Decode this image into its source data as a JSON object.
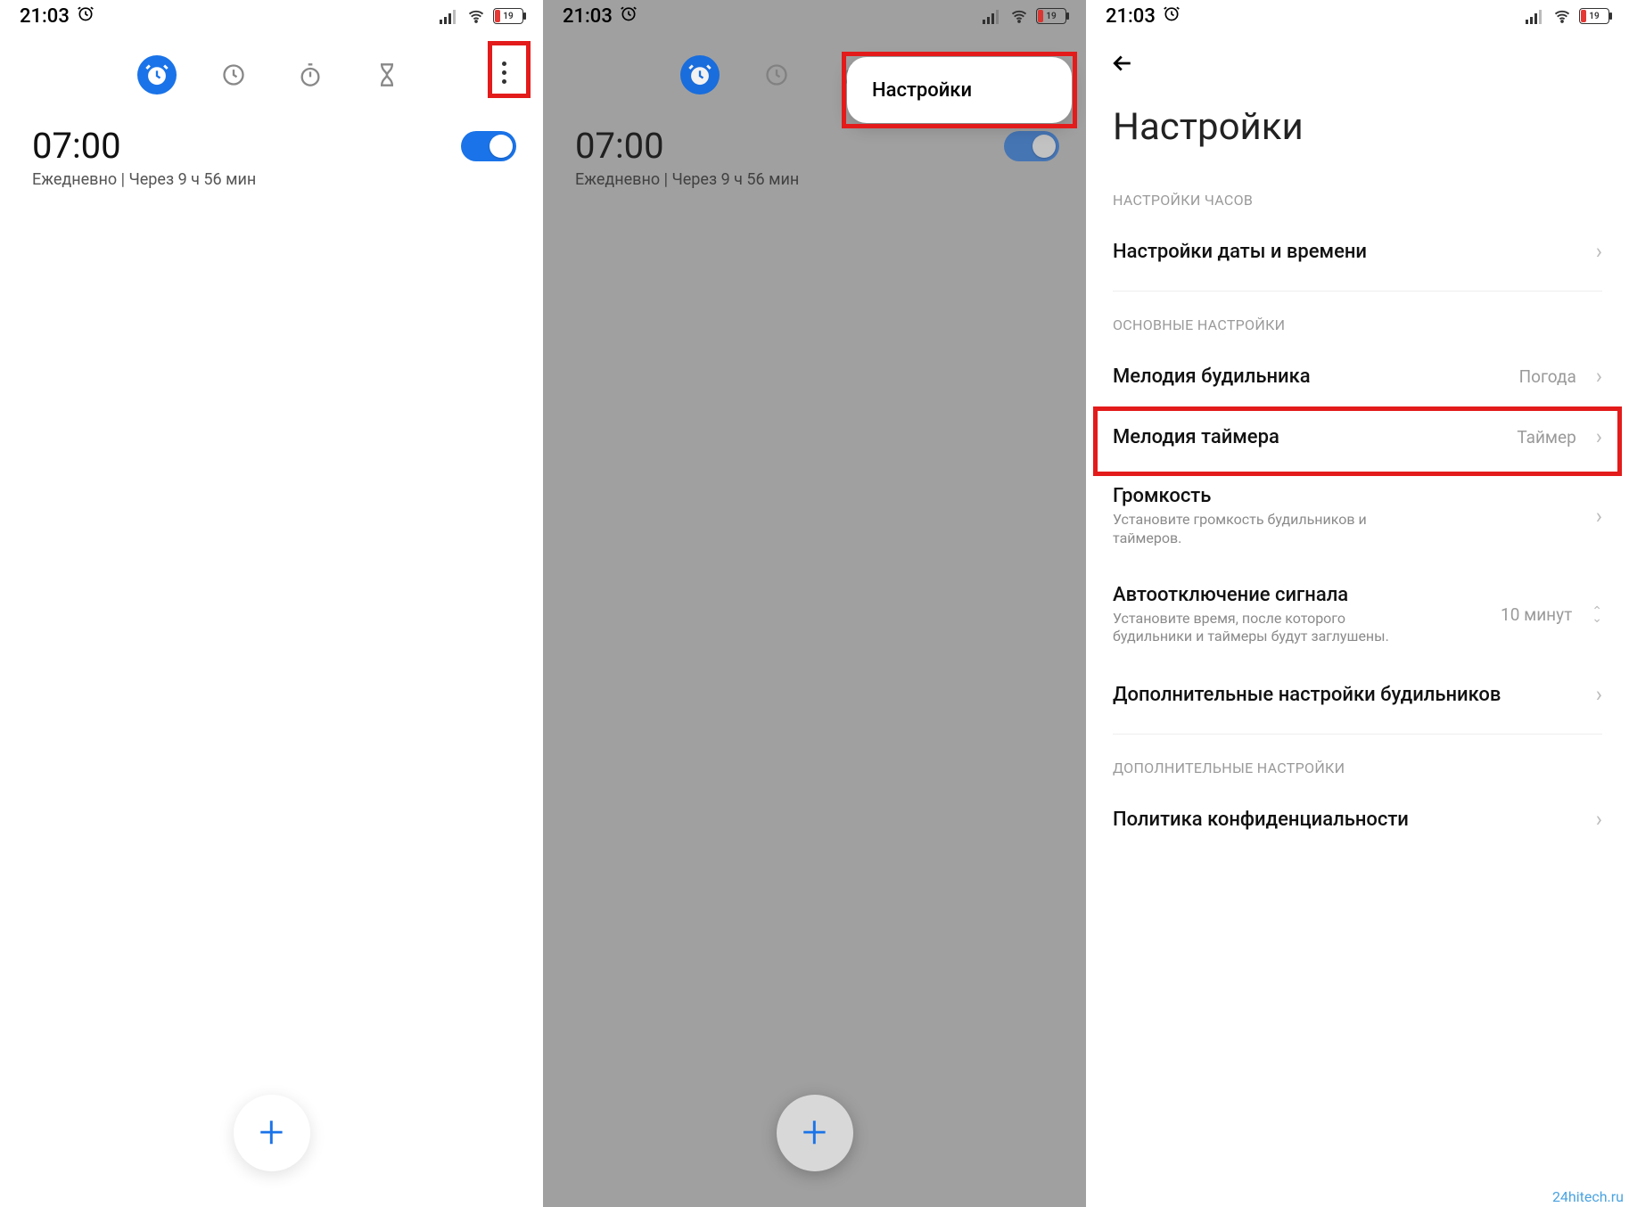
{
  "status": {
    "time": "21:03",
    "battery_text": "19"
  },
  "screen1": {
    "alarm_time": "07:00",
    "alarm_sub": "Ежедневно  |  Через 9 ч 56 мин"
  },
  "screen2": {
    "alarm_time": "07:00",
    "alarm_sub": "Ежедневно  |  Через 9 ч 56 мин",
    "popup_label": "Настройки"
  },
  "screen3": {
    "title": "Настройки",
    "section_clock": "НАСТРОЙКИ ЧАСОВ",
    "row_date_time": "Настройки даты и времени",
    "section_main": "ОСНОВНЫЕ НАСТРОЙКИ",
    "row_alarm_ringtone": "Мелодия будильника",
    "row_alarm_ringtone_value": "Погода",
    "row_timer_ringtone": "Мелодия таймера",
    "row_timer_ringtone_value": "Таймер",
    "row_volume": "Громкость",
    "row_volume_desc": "Установите громкость будильников и таймеров.",
    "row_auto_silence": "Автоотключение сигнала",
    "row_auto_silence_desc": "Установите время, после которого будильники и таймеры будут заглушены.",
    "row_auto_silence_value": "10 минут",
    "row_more_alarm": "Дополнительные настройки будильников",
    "section_extra": "ДОПОЛНИТЕЛЬНЫЕ НАСТРОЙКИ",
    "row_privacy": "Политика конфиденциальности"
  },
  "watermark": "24hitech.ru"
}
